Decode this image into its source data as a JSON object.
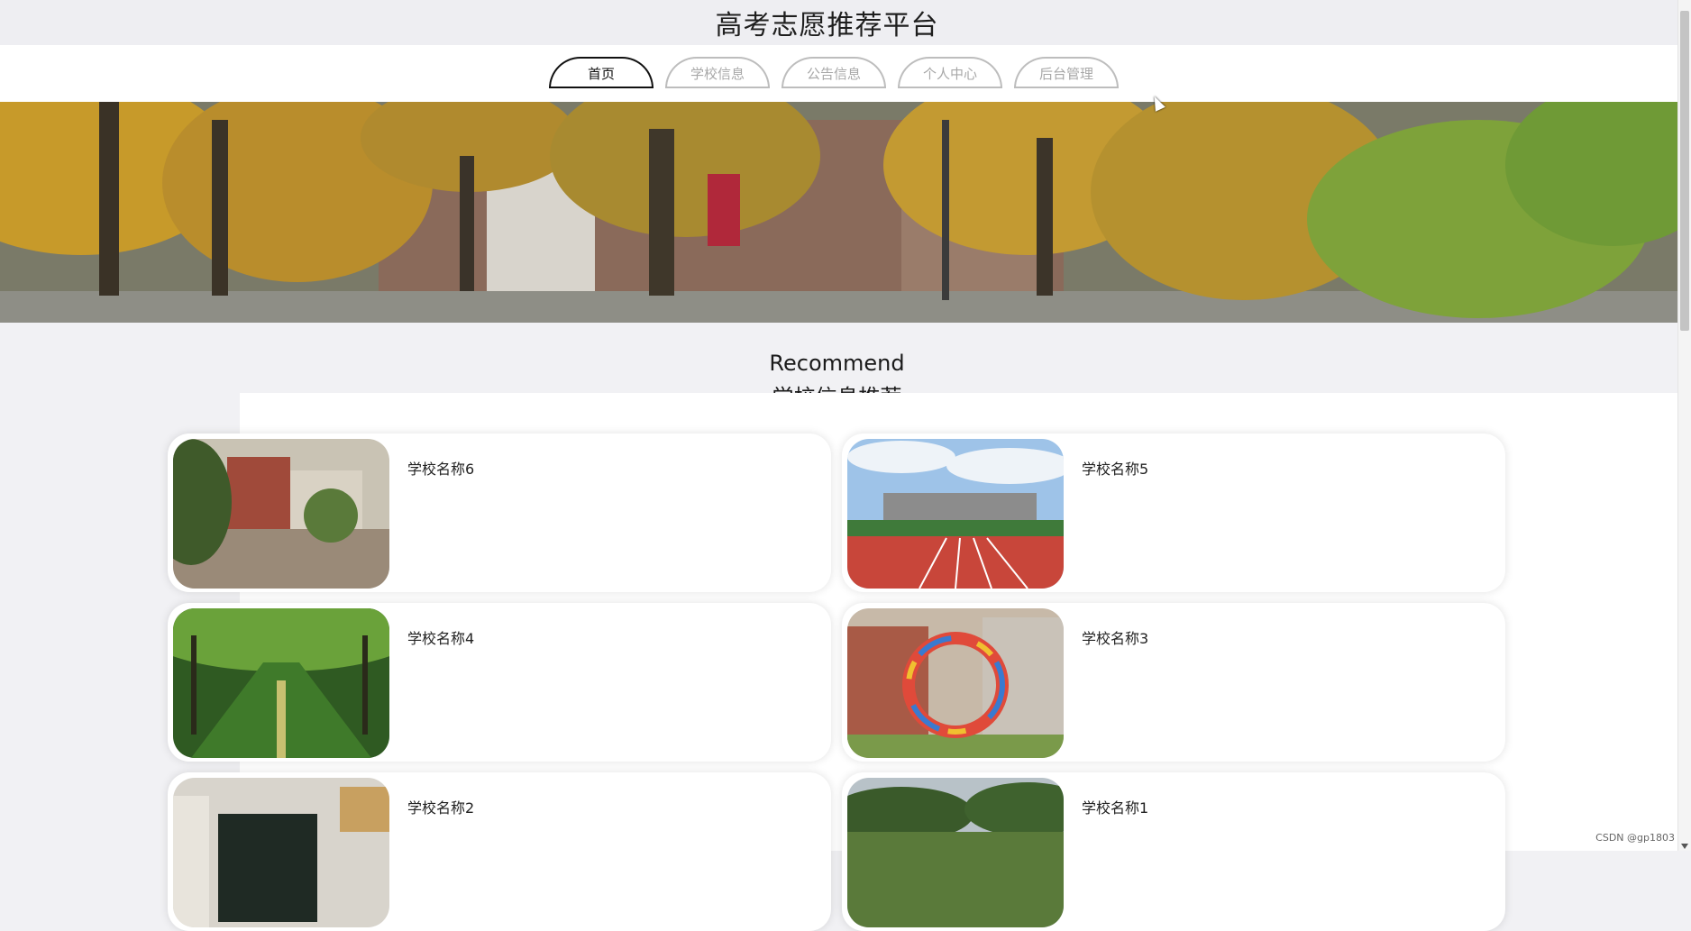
{
  "header": {
    "title": "高考志愿推荐平台"
  },
  "nav": {
    "items": [
      {
        "label": "首页",
        "active": true
      },
      {
        "label": "学校信息",
        "active": false
      },
      {
        "label": "公告信息",
        "active": false
      },
      {
        "label": "个人中心",
        "active": false
      },
      {
        "label": "后台管理",
        "active": false
      }
    ]
  },
  "recommend": {
    "title_en": "Recommend",
    "title_cn": "学校信息推荐",
    "schools": [
      {
        "name": "学校名称6",
        "image": "campus-street-photo"
      },
      {
        "name": "学校名称5",
        "image": "running-track-photo"
      },
      {
        "name": "学校名称4",
        "image": "tree-lined-path-photo"
      },
      {
        "name": "学校名称3",
        "image": "ring-sculpture-photo"
      },
      {
        "name": "学校名称2",
        "image": "classroom-photo"
      },
      {
        "name": "学校名称1",
        "image": "sports-field-photo"
      }
    ]
  },
  "footer": {
    "watermark": "CSDN @gp1803"
  },
  "colors": {
    "nav_active": "#111111",
    "nav_inactive": "#a8a8a8",
    "page_bg": "#f1f1f4"
  }
}
